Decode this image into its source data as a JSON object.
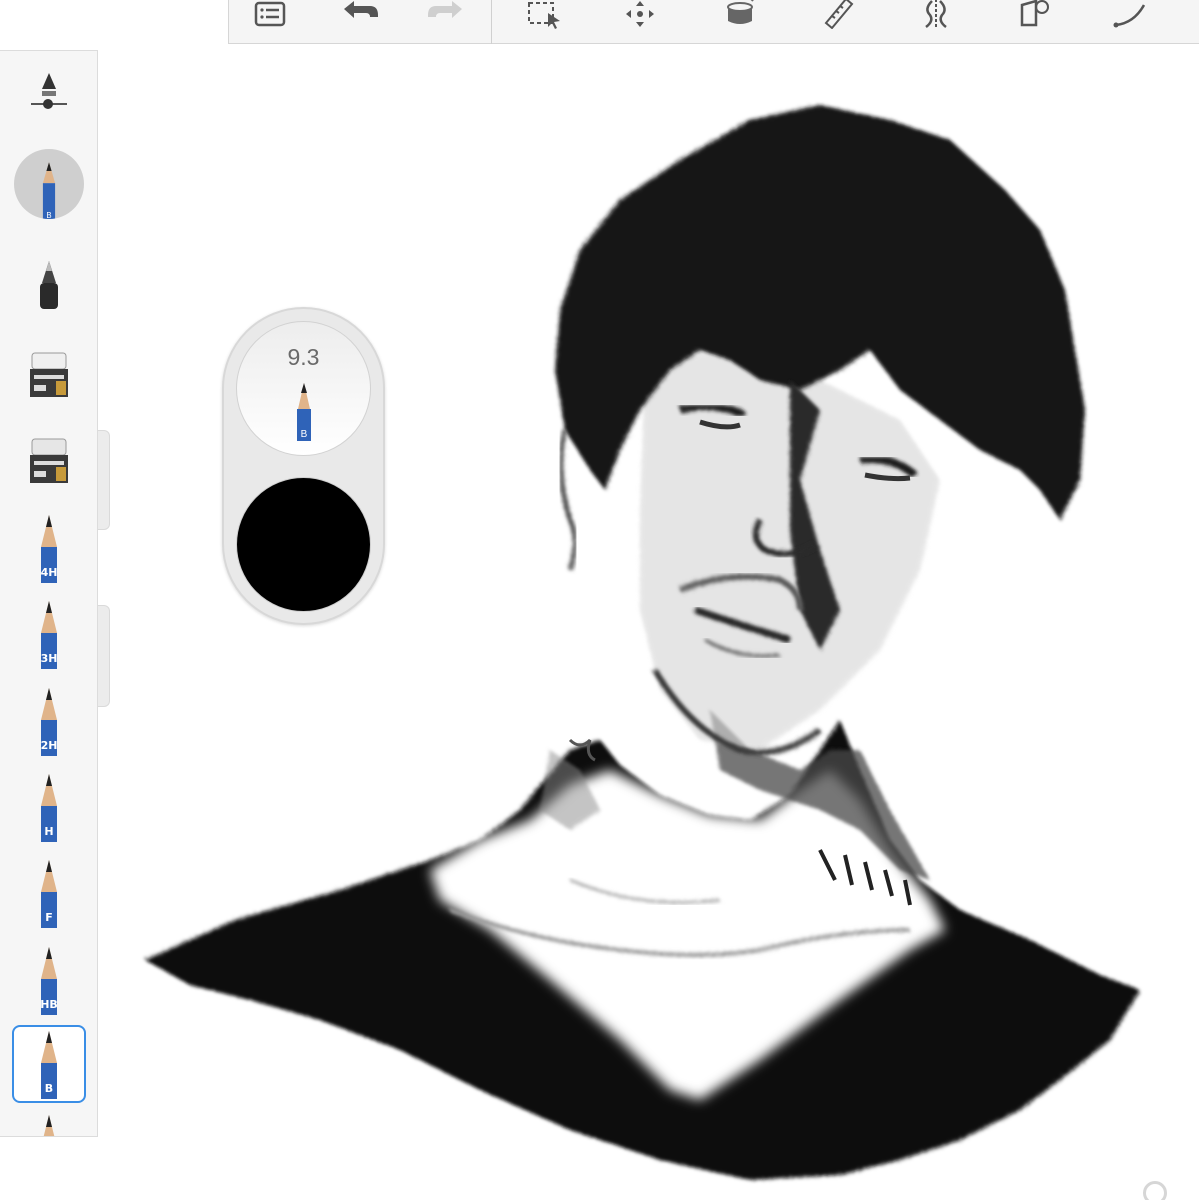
{
  "toolbar": {
    "buttons": [
      {
        "id": "layers",
        "icon": "list-icon"
      },
      {
        "id": "undo",
        "icon": "undo-icon"
      },
      {
        "id": "redo",
        "icon": "redo-icon"
      },
      {
        "id": "select",
        "icon": "selection-icon"
      },
      {
        "id": "transform",
        "icon": "move-icon"
      },
      {
        "id": "fill",
        "icon": "fill-bucket-icon"
      },
      {
        "id": "ruler",
        "icon": "ruler-icon"
      },
      {
        "id": "symmetry",
        "icon": "symmetry-icon"
      },
      {
        "id": "perspective",
        "icon": "perspective-guide-icon"
      },
      {
        "id": "stroke",
        "icon": "curve-icon"
      }
    ]
  },
  "sidebar": {
    "opacity_icon": "opacity-slider-icon",
    "current_brush": {
      "grade": "B",
      "icon": "pencil-icon"
    },
    "brushes": [
      {
        "name": "marker",
        "icon": "marker-icon",
        "grade": ""
      },
      {
        "name": "eraser-hard",
        "icon": "eraser-icon",
        "grade": ""
      },
      {
        "name": "eraser-soft",
        "icon": "soft-eraser-icon",
        "grade": ""
      },
      {
        "name": "pencil-4h",
        "icon": "pencil-icon",
        "grade": "4H"
      },
      {
        "name": "pencil-3h",
        "icon": "pencil-icon",
        "grade": "3H"
      },
      {
        "name": "pencil-2h",
        "icon": "pencil-icon",
        "grade": "2H"
      },
      {
        "name": "pencil-h",
        "icon": "pencil-icon",
        "grade": "H"
      },
      {
        "name": "pencil-f",
        "icon": "pencil-icon",
        "grade": "F"
      },
      {
        "name": "pencil-hb",
        "icon": "pencil-icon",
        "grade": "HB"
      },
      {
        "name": "pencil-b",
        "icon": "pencil-icon",
        "grade": "B",
        "selected": true
      },
      {
        "name": "pencil-more",
        "icon": "pencil-icon",
        "grade": ""
      }
    ]
  },
  "puck": {
    "size_value": "9.3",
    "brush_grade": "B",
    "color": "#000000"
  },
  "colors": {
    "accent": "#3a8ee6",
    "pencil_blue": "#2f63b8"
  },
  "canvas": {
    "description_icon": "sketch-canvas",
    "handle_icon": "canvas-rotate-handle-icon"
  }
}
